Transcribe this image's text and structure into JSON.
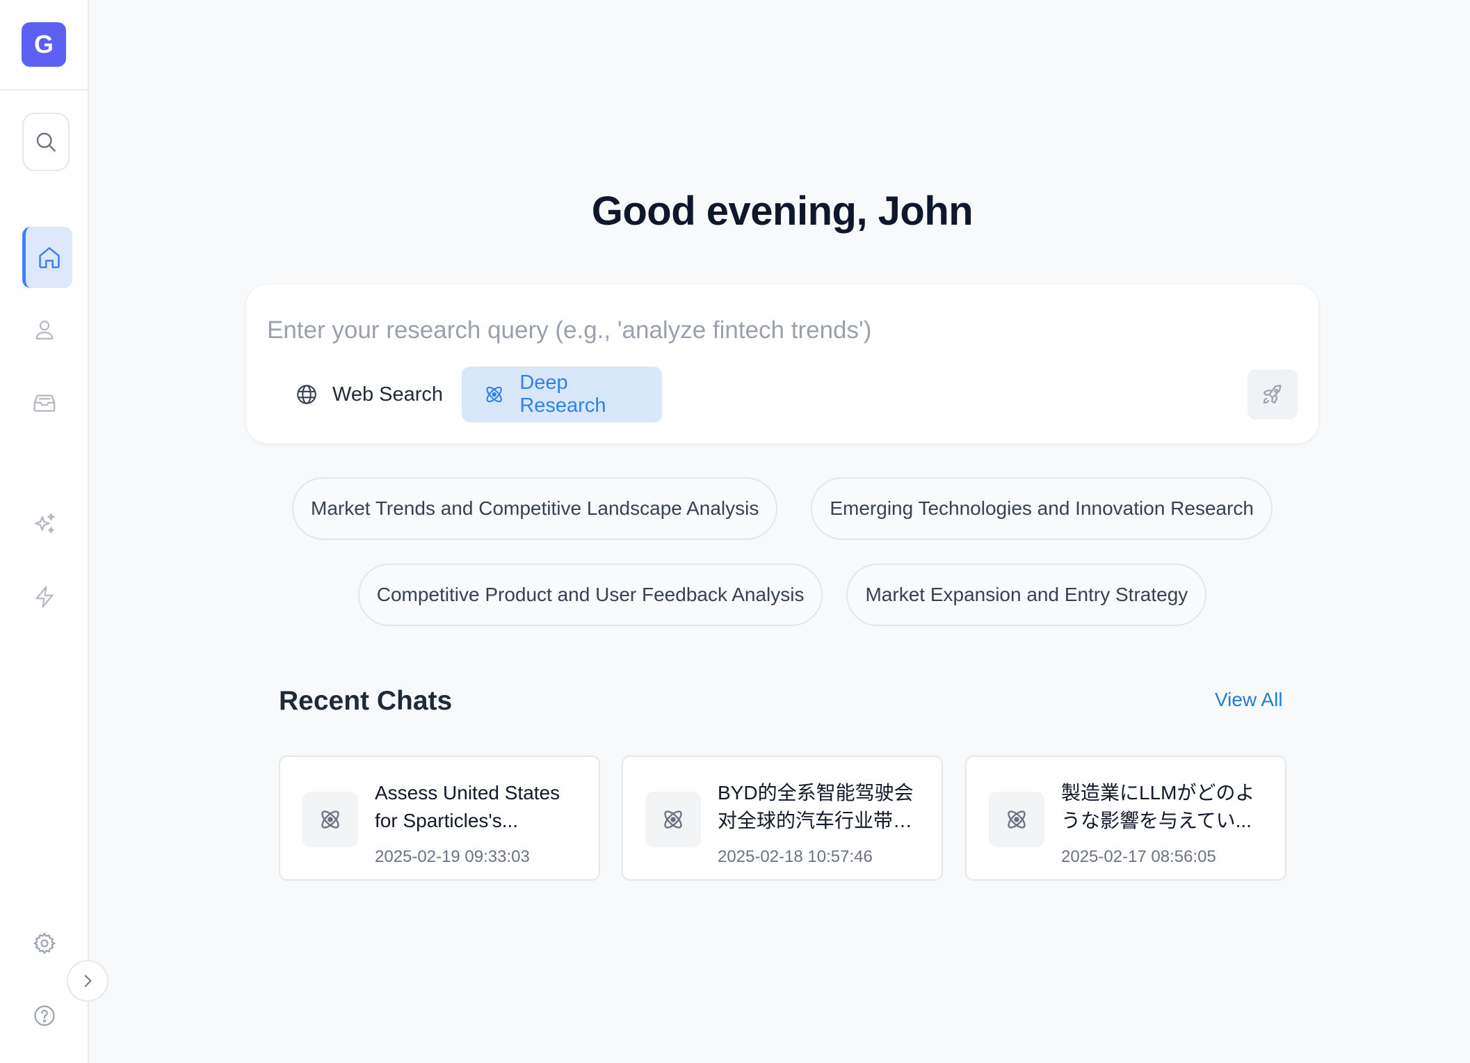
{
  "app": {
    "logo_letter": "G",
    "brand_color": "#5b5ff2",
    "accent_color": "#3b82f6"
  },
  "sidebar": {
    "items": [
      {
        "name": "search",
        "icon": "search-icon"
      },
      {
        "name": "home",
        "icon": "home-icon",
        "active": true
      },
      {
        "name": "profile",
        "icon": "user-icon"
      },
      {
        "name": "inbox",
        "icon": "inbox-icon"
      },
      {
        "name": "sparkles",
        "icon": "sparkles-icon"
      },
      {
        "name": "lightning",
        "icon": "lightning-icon"
      },
      {
        "name": "settings",
        "icon": "gear-icon"
      },
      {
        "name": "help",
        "icon": "help-icon"
      }
    ],
    "toggle_icon": "chevron-right-icon"
  },
  "main": {
    "greeting": "Good evening, John",
    "query": {
      "value": "",
      "placeholder": "Enter your research query (e.g., 'analyze fintech trends')"
    },
    "modes": {
      "web_search": "Web Search",
      "deep_research": "Deep Research",
      "selected": "Deep Research"
    },
    "suggestions": [
      "Market Trends and Competitive Landscape Analysis",
      "Emerging Technologies and Innovation Research",
      "Competitive Product and User Feedback Analysis",
      "Market Expansion and Entry Strategy"
    ],
    "recent": {
      "title": "Recent Chats",
      "view_all": "View All",
      "chats": [
        {
          "title": "Assess United States for Sparticles's...",
          "time": "2025-02-19 09:33:03"
        },
        {
          "title": "BYD的全系智能驾驶会对全球的汽车行业带来...",
          "time": "2025-02-18 10:57:46"
        },
        {
          "title": "製造業にLLMがどのような影響を与えてい...",
          "time": "2025-02-17 08:56:05"
        }
      ]
    }
  }
}
